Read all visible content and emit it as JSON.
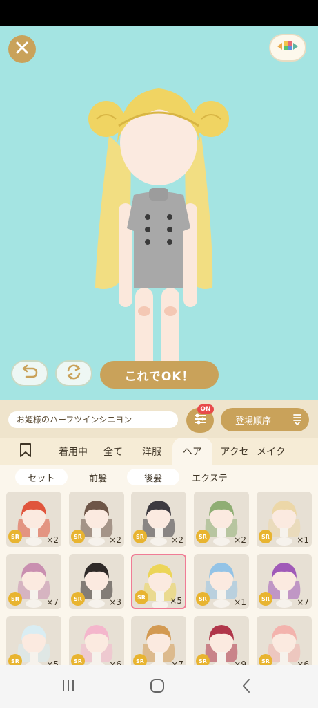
{
  "header": {
    "close_icon": "close-icon",
    "palette_icon": "color-palette-icon"
  },
  "actions": {
    "undo_icon": "undo-icon",
    "shuffle_icon": "shuffle-icon",
    "ok_label": "これでOK！"
  },
  "panel": {
    "item_name": "お姫様のハーフツインシニヨン",
    "filter_badge": "ON",
    "sort_label": "登場順序",
    "category_tabs": [
      {
        "label": "着用中"
      },
      {
        "label": "全て"
      },
      {
        "label": "洋服"
      },
      {
        "label": "ヘア"
      },
      {
        "label": "アクセ"
      },
      {
        "label": "メイク"
      }
    ],
    "sub_tabs": [
      {
        "label": "セット"
      },
      {
        "label": "前髪"
      },
      {
        "label": "後髪"
      },
      {
        "label": "エクステ"
      }
    ],
    "items": [
      {
        "rarity": "SR",
        "count": "×2",
        "hair_color": "#e0553c"
      },
      {
        "rarity": "SR",
        "count": "×2",
        "hair_color": "#6e5648"
      },
      {
        "rarity": "SR",
        "count": "×2",
        "hair_color": "#3d3a40"
      },
      {
        "rarity": "SR",
        "count": "×2",
        "hair_color": "#8fae74"
      },
      {
        "rarity": "SR",
        "count": "×1",
        "hair_color": "#ecd7a8"
      },
      {
        "rarity": "SR",
        "count": "×7",
        "hair_color": "#c98fb0"
      },
      {
        "rarity": "SR",
        "count": "×3",
        "hair_color": "#2f2a28"
      },
      {
        "rarity": "SR",
        "count": "×5",
        "hair_color": "#ecd558"
      },
      {
        "rarity": "SR",
        "count": "×1",
        "hair_color": "#93c3e6"
      },
      {
        "rarity": "SR",
        "count": "×7",
        "hair_color": "#a05ab8"
      },
      {
        "rarity": "SR",
        "count": "×5",
        "hair_color": "#d9edf3"
      },
      {
        "rarity": "SR",
        "count": "×6",
        "hair_color": "#f4b6cc"
      },
      {
        "rarity": "SR",
        "count": "×7",
        "hair_color": "#d39a52"
      },
      {
        "rarity": "SR",
        "count": "×9",
        "hair_color": "#b0364a"
      },
      {
        "rarity": "SR",
        "count": "×6",
        "hair_color": "#f3b3ad"
      }
    ]
  },
  "colors": {
    "accent": "#c9a25a",
    "stage_bg": "#a4e4e2",
    "selected_border": "#f07c95",
    "badge_red": "#e84a4a"
  }
}
